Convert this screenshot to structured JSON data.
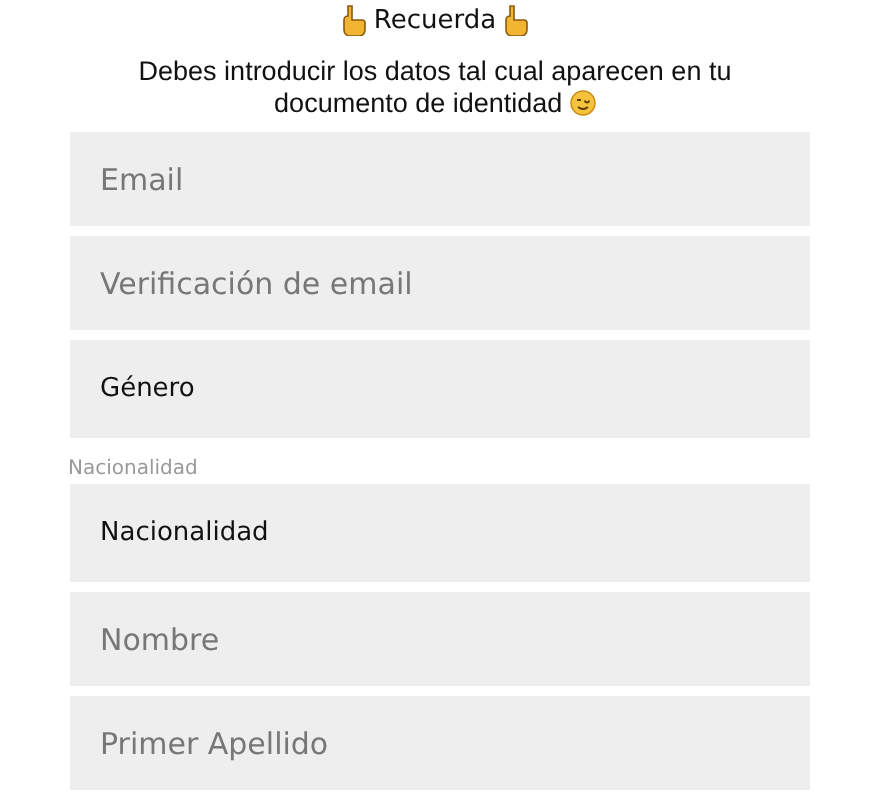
{
  "heading": "Recuerda",
  "notice": "Debes introducir los datos tal cual aparecen en tu documento de identidad",
  "fields": [
    {
      "kind": "input",
      "placeholder": "Email"
    },
    {
      "kind": "input",
      "placeholder": "Verificación de email"
    },
    {
      "kind": "select",
      "value": "Género"
    },
    {
      "kind": "select",
      "label": "Nacionalidad",
      "value": "Nacionalidad"
    },
    {
      "kind": "input",
      "placeholder": "Nombre"
    },
    {
      "kind": "input",
      "placeholder": "Primer Apellido"
    }
  ]
}
